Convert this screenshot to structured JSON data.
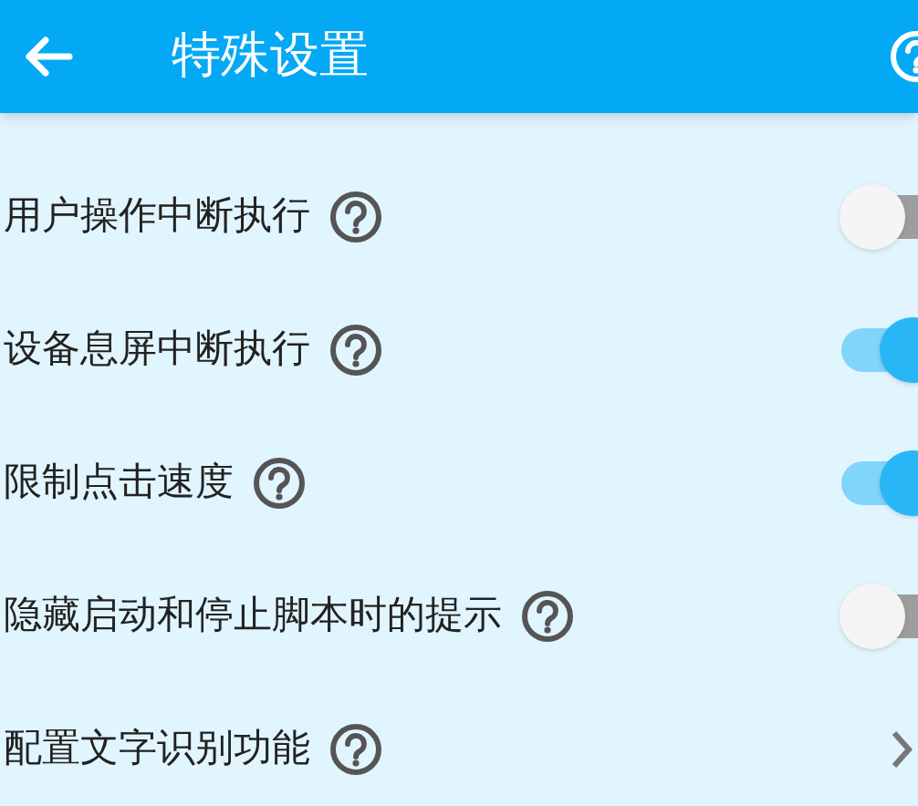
{
  "header": {
    "title": "特殊设置"
  },
  "settings": [
    {
      "kind": "toggle",
      "label": "用户操作中断执行",
      "on": false
    },
    {
      "kind": "toggle",
      "label": "设备息屏中断执行",
      "on": true
    },
    {
      "kind": "toggle",
      "label": "限制点击速度",
      "on": true
    },
    {
      "kind": "toggle",
      "label": "隐藏启动和停止脚本时的提示",
      "on": false
    },
    {
      "kind": "link",
      "label": "配置文字识别功能"
    }
  ]
}
